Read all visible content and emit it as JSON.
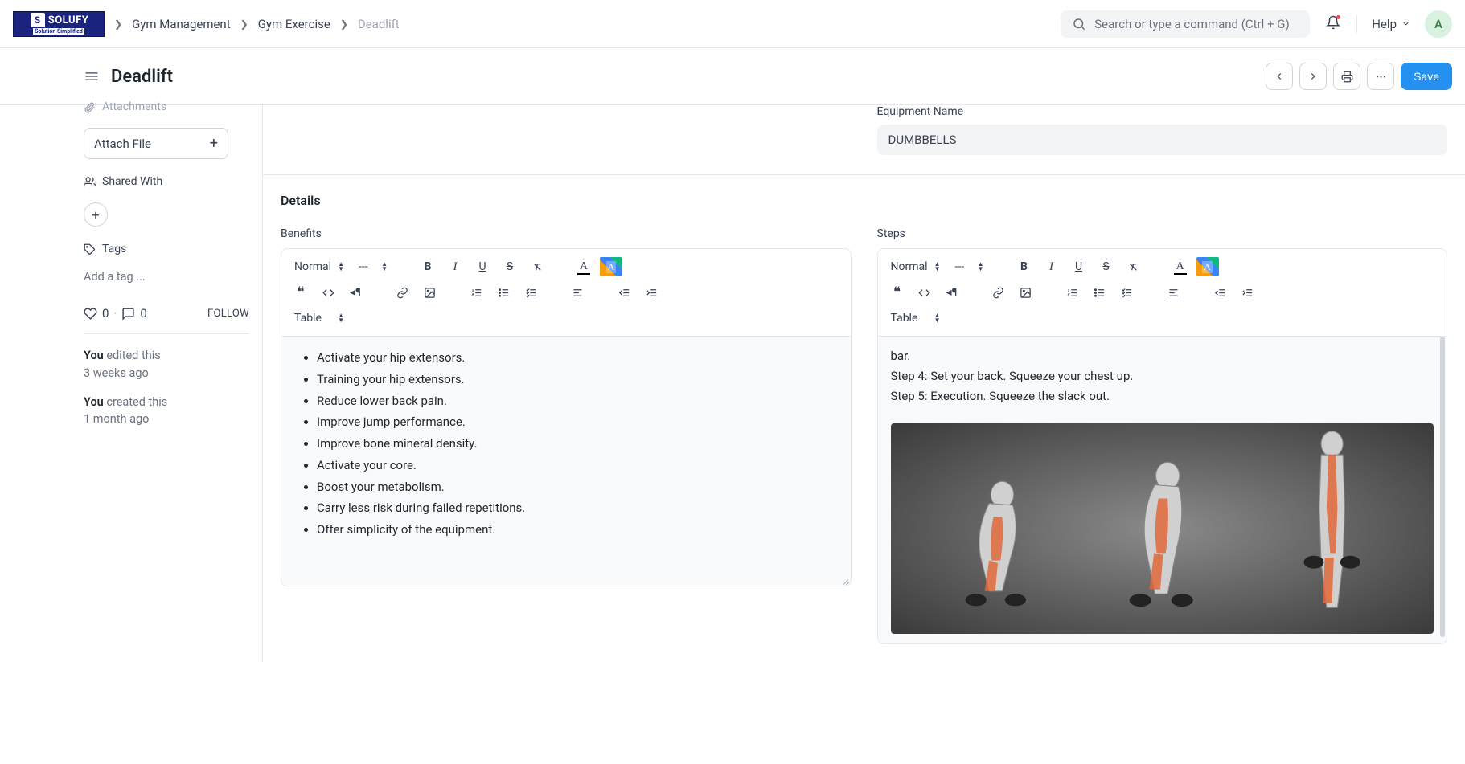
{
  "brand": {
    "name": "SOLUFY",
    "tagline": "Solution Simplified"
  },
  "breadcrumb": {
    "items": [
      "Gym Management",
      "Gym Exercise",
      "Deadlift"
    ]
  },
  "search": {
    "placeholder": "Search or type a command (Ctrl + G)"
  },
  "help": {
    "label": "Help"
  },
  "avatar": {
    "initial": "A"
  },
  "page": {
    "title": "Deadlift",
    "save": "Save"
  },
  "sidebar": {
    "attachments_header": "Attachments",
    "attach_label": "Attach File",
    "shared_header": "Shared With",
    "tags_header": "Tags",
    "tags_placeholder": "Add a tag ...",
    "likes": "0",
    "comments": "0",
    "follow": "FOLLOW",
    "timeline": [
      {
        "who": "You",
        "action": "edited this",
        "when": "3 weeks ago"
      },
      {
        "who": "You",
        "action": "created this",
        "when": "1 month ago"
      }
    ]
  },
  "form": {
    "equipment_label": "Equipment Name",
    "equipment_value": "DUMBBELLS",
    "details_title": "Details",
    "benefits_label": "Benefits",
    "steps_label": "Steps",
    "toolbar": {
      "normal": "Normal",
      "dash": "---",
      "table": "Table"
    },
    "benefits_items": [
      "Activate your hip extensors.",
      "Training your hip extensors.",
      "Reduce lower back pain.",
      "Improve jump performance.",
      "Improve bone mineral density.",
      "Activate your core.",
      "Boost your metabolism.",
      "Carry less risk during failed repetitions.",
      "Offer simplicity of the equipment."
    ],
    "steps_lines": [
      "bar.",
      "Step 4: Set your back. Squeeze your chest up.",
      "Step 5: Execution. Squeeze the slack out."
    ]
  }
}
